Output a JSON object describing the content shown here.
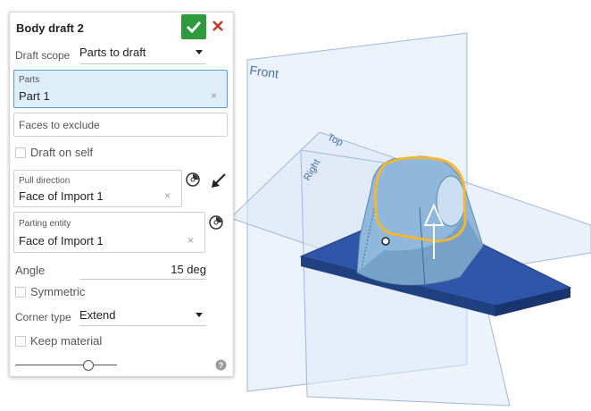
{
  "dialog": {
    "title": "Body draft 2",
    "draft_scope": {
      "label": "Draft scope",
      "value": "Parts to draft"
    },
    "parts": {
      "label": "Parts",
      "value": "Part 1"
    },
    "faces_to_exclude": {
      "placeholder": "Faces to exclude"
    },
    "draft_on_self": {
      "label": "Draft on self",
      "checked": false
    },
    "pull_direction": {
      "label": "Pull direction",
      "value": "Face of Import 1"
    },
    "parting_entity": {
      "label": "Parting entity",
      "value": "Face of Import 1"
    },
    "angle": {
      "label": "Angle",
      "value": "15 deg"
    },
    "symmetric": {
      "label": "Symmetric",
      "checked": false
    },
    "corner_type": {
      "label": "Corner type",
      "value": "Extend"
    },
    "keep_material": {
      "label": "Keep material",
      "checked": false
    },
    "slider": {
      "value": 0.72
    },
    "colors": {
      "accept": "#2f9a3c",
      "cancel": "#c0392b",
      "active_field": "#ddeef9"
    }
  },
  "viewport": {
    "plane_labels": {
      "front": "Front",
      "top": "Top",
      "right": "Right"
    },
    "colors": {
      "plane": "#d9e6f5",
      "base_plate": "#2f56a8",
      "part": "#8fb8dc",
      "highlight": "#f2b632"
    }
  }
}
